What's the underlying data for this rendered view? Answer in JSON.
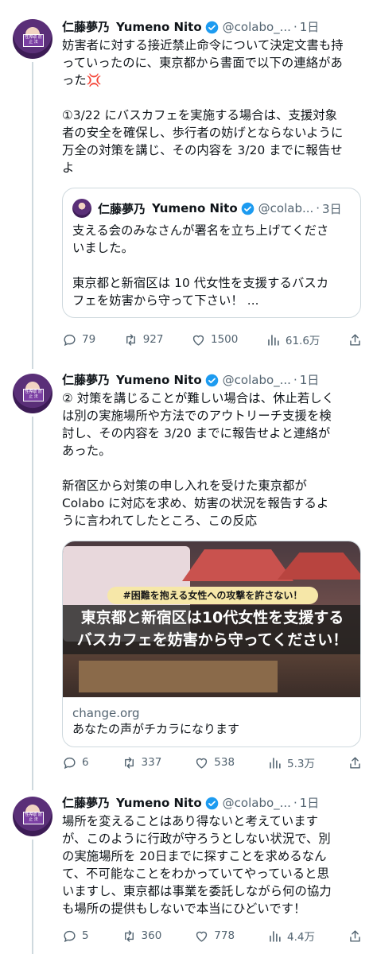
{
  "tweets": [
    {
      "author": {
        "name": "仁藤夢乃",
        "name_en": "Yumeno Nito",
        "handle": "@colabo_...",
        "time": "1日",
        "avatar_text": "性搾取\n防止\n法"
      },
      "lines1": [
        "妨害者に対する接近禁止命令について決定文書も持",
        "っていったのに、東京都から書面で以下の連絡があ",
        "った💢"
      ],
      "lines2": [
        "①3/22 にバスカフェを実施する場合は、支援対象",
        "者の安全を確保し、歩行者の妨げとならないように",
        "万全の対策を講じ、その内容を 3/20 までに報告せ",
        "よ"
      ],
      "quote": {
        "name": "仁藤夢乃",
        "name_en": "Yumeno Nito",
        "handle": "@colab...",
        "time": "3日",
        "lines1": [
          "支える会のみなさんが署名を立ち上げてくださ",
          "いました。"
        ],
        "lines2": [
          "東京都と新宿区は 10 代女性を支援するバスカ",
          "フェを妨害から守って下さい！ ..."
        ]
      },
      "stats": {
        "replies": "79",
        "retweets": "927",
        "likes": "1500",
        "views": "61.6万"
      }
    },
    {
      "author": {
        "name": "仁藤夢乃",
        "name_en": "Yumeno Nito",
        "handle": "@colabo_...",
        "time": "1日"
      },
      "lines1": [
        "② 対策を講じることが難しい場合は、休止若しく",
        "は別の実施場所や方法でのアウトリーチ支援を検",
        "討し、その内容を 3/20 までに報告せよと連絡が",
        "あった。"
      ],
      "lines2": [
        "新宿区から対策の申し入れを受けた東京都が",
        "Colabo に対応を求め、妨害の状況を報告するよ",
        "うに言われてしたところ、この反応"
      ],
      "card": {
        "banner_small": "#困難を抱える女性への攻撃を許さない！",
        "banner_line1": "東京都と新宿区は10代女性を支援する",
        "banner_line2": "バスカフェを妨害から守ってください！",
        "domain": "change.org",
        "caption": "あなたの声がチカラになります"
      },
      "stats": {
        "replies": "6",
        "retweets": "337",
        "likes": "538",
        "views": "5.3万"
      }
    },
    {
      "author": {
        "name": "仁藤夢乃",
        "name_en": "Yumeno Nito",
        "handle": "@colabo_...",
        "time": "1日"
      },
      "lines1": [
        "場所を変えることはあり得ないと考えています",
        "が、このように行政が守ろうとしない状況で、別",
        "の実施場所を 20日までに探すことを求めるなん",
        "て、不可能なことをわかっていてやっていると思",
        "いますし、東京都は事業を委託しながら何の協力",
        "も場所の提供もしないで本当にひどいです！"
      ],
      "stats": {
        "replies": "5",
        "retweets": "360",
        "likes": "778",
        "views": "4.4万"
      }
    }
  ],
  "colors": {
    "text": "#0f1419",
    "secondary": "#536471",
    "verified": "#1d9bf0",
    "border": "#cfd9de"
  }
}
